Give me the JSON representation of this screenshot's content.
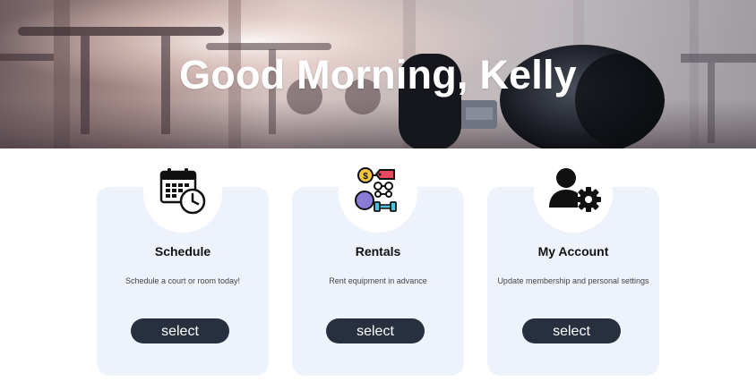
{
  "hero": {
    "greeting": "Good Morning, Kelly"
  },
  "cards": [
    {
      "title": "Schedule",
      "description": "Schedule a court or room today!",
      "button_label": "select",
      "icon": "calendar-clock-icon"
    },
    {
      "title": "Rentals",
      "description": "Rent equipment in advance",
      "button_label": "select",
      "icon": "equipment-rental-icon"
    },
    {
      "title": "My Account",
      "description": "Update membership and personal settings",
      "button_label": "select",
      "icon": "user-settings-icon"
    }
  ],
  "colors": {
    "card_background": "#eef3fb",
    "button_background": "#283040",
    "button_text": "#ffffff"
  }
}
